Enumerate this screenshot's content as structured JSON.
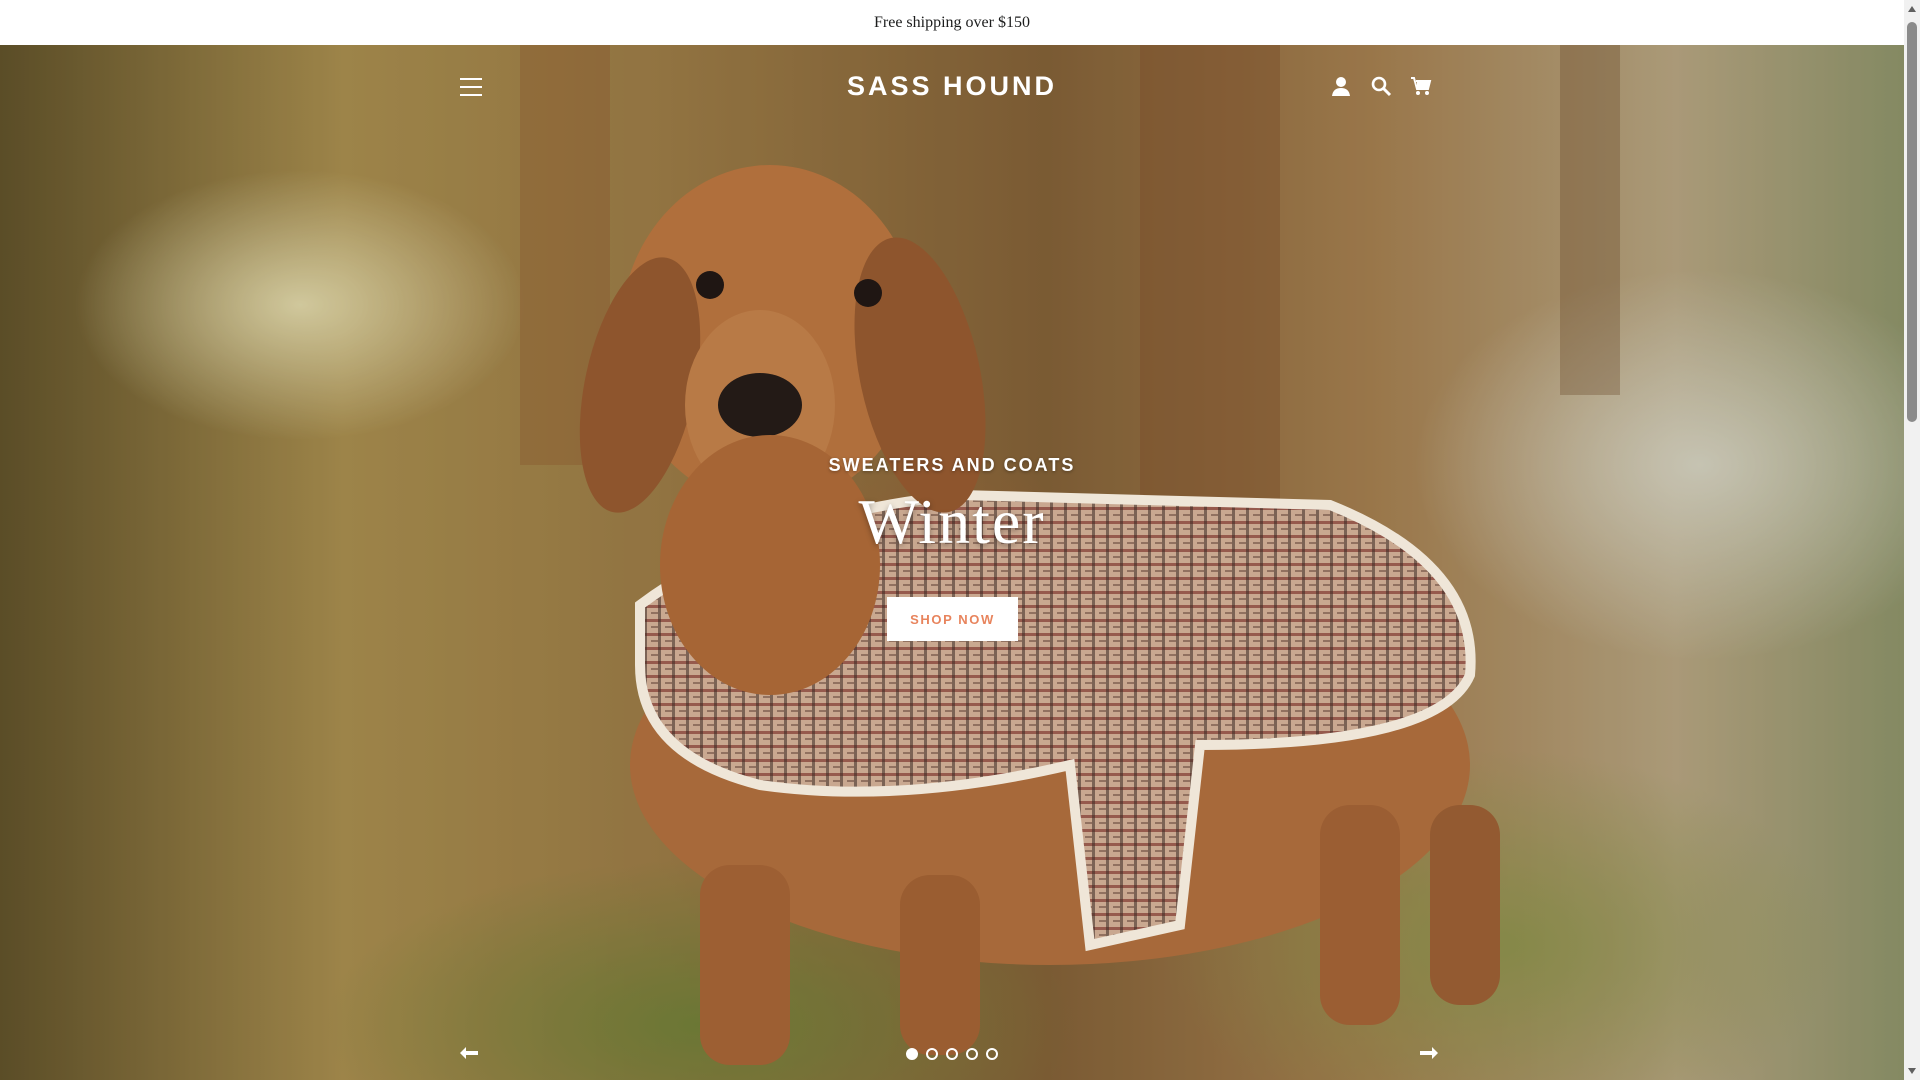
{
  "announcement": {
    "text": "Free shipping over $150"
  },
  "header": {
    "logo": "SASS HOUND",
    "icons": [
      "menu-icon",
      "account-icon",
      "search-icon",
      "cart-icon"
    ]
  },
  "slideshow": {
    "eyebrow": "SWEATERS AND COATS",
    "headline": "Winter",
    "cta_label": "SHOP NOW",
    "slide_count": 5,
    "active_slide": 1,
    "image_alt_subject": "dachshund wearing plaid coat"
  },
  "colors": {
    "cta_text": "#e8845d",
    "text_on_image": "#ffffff"
  }
}
